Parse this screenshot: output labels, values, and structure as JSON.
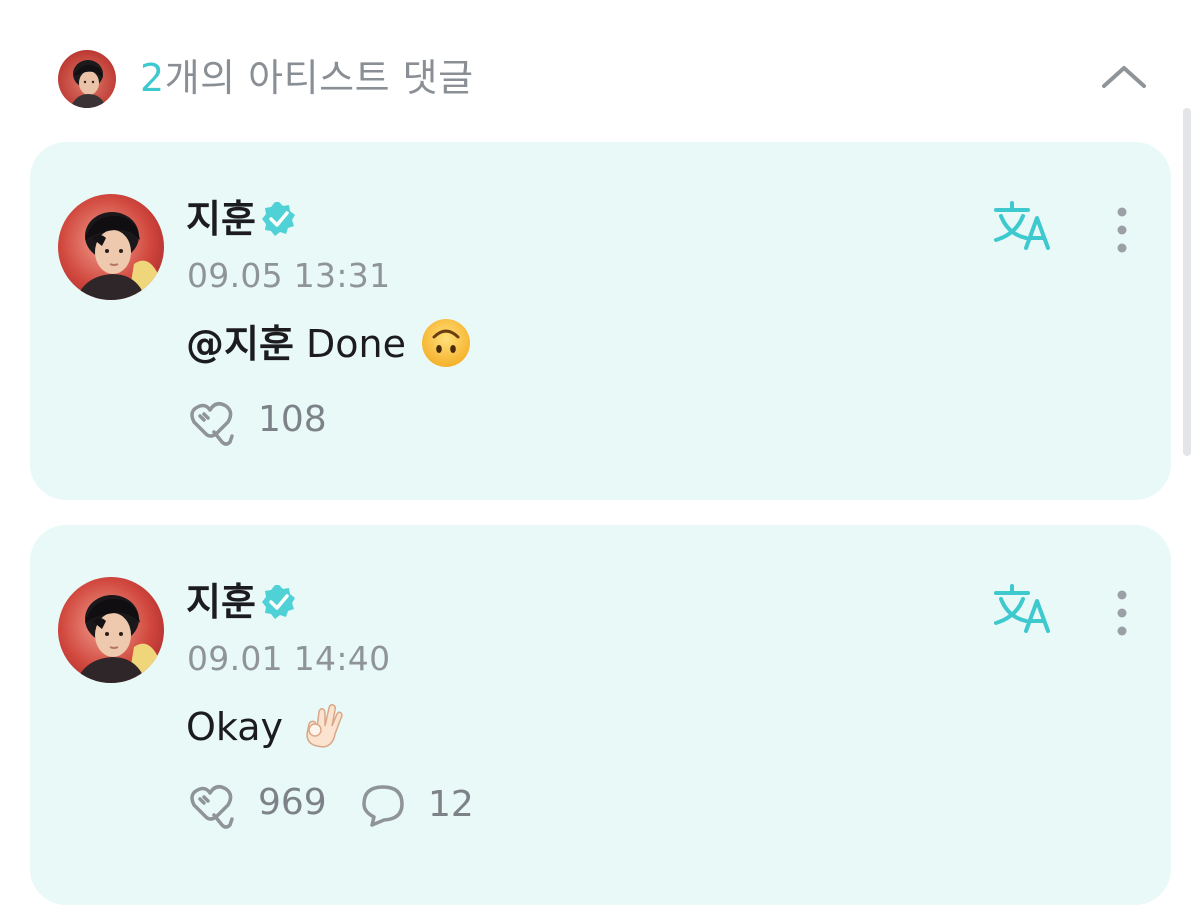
{
  "header": {
    "count": "2",
    "title_suffix": "개의 아티스트 댓글",
    "avatar_icon": "artist-avatar",
    "collapse_icon": "chevron-up-icon"
  },
  "colors": {
    "accent": "#3ec9cf",
    "card_background": "#e8f9f8",
    "muted_text": "#8f9499",
    "primary_text": "#1c1c1e"
  },
  "comments": [
    {
      "author": "지훈",
      "verified": true,
      "timestamp": "09.05 13:31",
      "mention": "@지훈",
      "text": " Done",
      "emoji": "upside-down-face",
      "likes": "108",
      "replies": null
    },
    {
      "author": "지훈",
      "verified": true,
      "timestamp": "09.01 14:40",
      "mention": "",
      "text": "Okay",
      "emoji": "ok-hand",
      "likes": "969",
      "replies": "12"
    }
  ]
}
